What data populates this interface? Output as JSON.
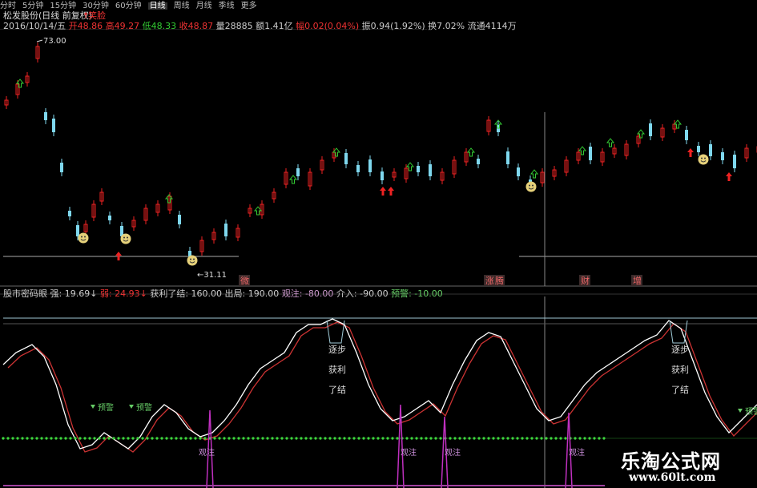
{
  "tabs": [
    "分时",
    "5分钟",
    "15分钟",
    "30分钟",
    "60分钟",
    "日线",
    "周线",
    "月线",
    "季线",
    "更多"
  ],
  "active_tab": "日线",
  "stock_title": "松发股份(日线 前复权)",
  "legend_red": "笑脸",
  "quote": {
    "date": "2016/10/14/五",
    "open_label": "开",
    "open": "48.86",
    "high_label": "高",
    "high": "49.27",
    "low_label": "低",
    "low": "48.33",
    "close_label": "收",
    "close": "48.87",
    "vol": "量28885",
    "amount": "额1.41亿",
    "chg_label": "幅",
    "chg": "0.02(0.04%)",
    "amp": "振0.94(1.92%)",
    "turn": "换7.02%",
    "float": "流通4114万"
  },
  "price_labels": {
    "high": "73.00",
    "low": "31.11"
  },
  "bottom_words": [
    "微",
    "涨",
    "腾",
    "财",
    "增"
  ],
  "indicator": {
    "name": "股市密码眼",
    "strong": "强: 19.69↓",
    "weak": "弱: 24.93↓",
    "profit": "获利了结: 160.00",
    "exit": "出局: 190.00",
    "watch": "观注: -80.00",
    "enter": "介入: -90.00",
    "warn": "预警: -10.00"
  },
  "signals": {
    "warn": "预警",
    "watch": "观注",
    "profit_step": [
      "逐步",
      "获利",
      "了结"
    ]
  },
  "watermark": {
    "cn": "乐淘公式网",
    "url": "www.60lt.com"
  },
  "colors": {
    "up": "#ee2222",
    "down": "#7fd8ee",
    "green_arrow": "#33cc33",
    "smile": "#e6d17a",
    "kline_white": "#ffffff",
    "kline_red": "#cc3333",
    "purple": "#c030c0",
    "green_dots": "#44ee44"
  }
}
